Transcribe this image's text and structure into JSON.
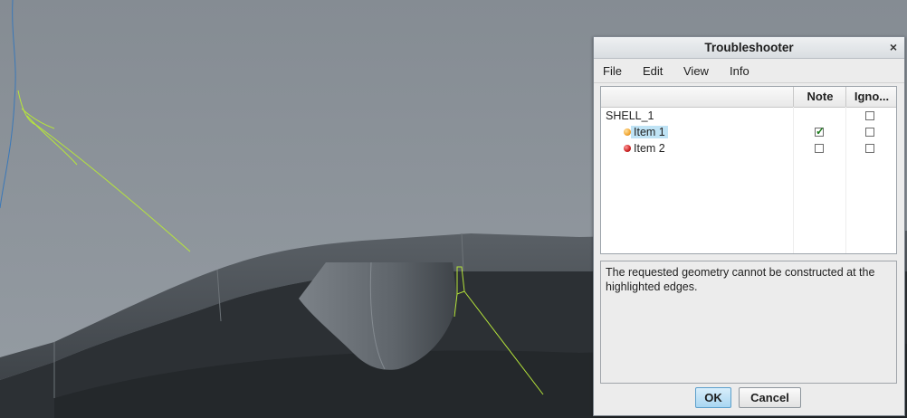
{
  "dialog": {
    "title": "Troubleshooter",
    "close_label": "×",
    "menu": [
      "File",
      "Edit",
      "View",
      "Info"
    ],
    "columns": {
      "note": "Note",
      "ignore": "Igno..."
    },
    "root": {
      "label": "SHELL_1",
      "ignored": false
    },
    "items": [
      {
        "label": "Item 1",
        "status_color": "#f2a530",
        "note": true,
        "ignored": false,
        "selected": true
      },
      {
        "label": "Item 2",
        "status_color": "#cc2222",
        "note": false,
        "ignored": false,
        "selected": false
      }
    ],
    "description": "The requested geometry cannot be constructed at the highlighted edges.",
    "ok_label": "OK",
    "cancel_label": "Cancel"
  },
  "colors": {
    "highlight_edge": "#b7e63a",
    "model_top": "#8c939a",
    "model_wall": "#4c5157",
    "selection": "#bfe3f5"
  }
}
